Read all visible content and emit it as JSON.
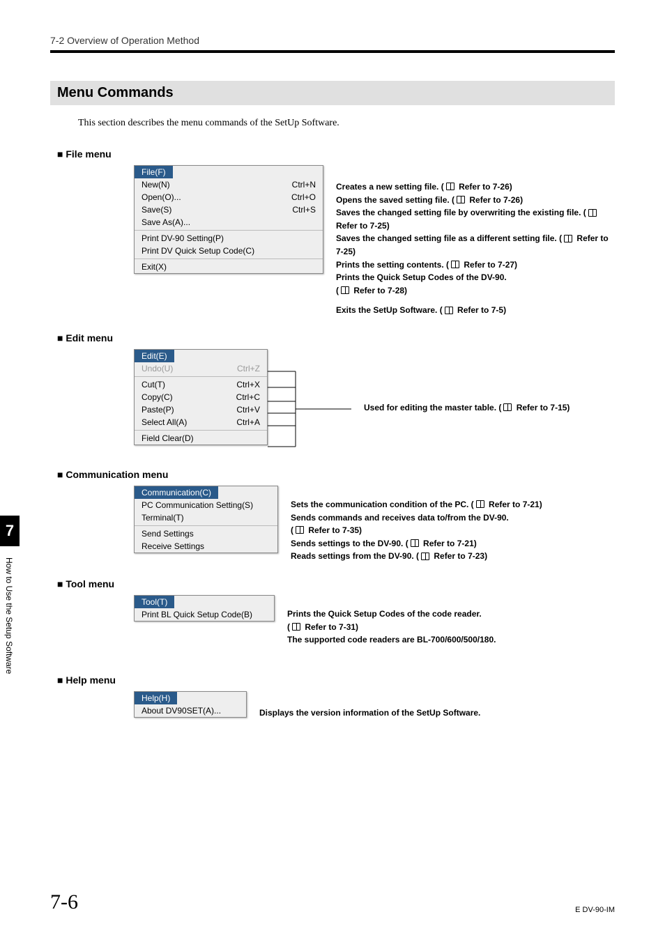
{
  "header": "7-2 Overview of Operation Method",
  "sectionTitle": "Menu Commands",
  "intro": "This section describes the menu commands of the SetUp Software.",
  "sideChapter": "7",
  "sideLabel": "How to Use the Setup Software",
  "pageNumber": "7-6",
  "docId": "E DV-90-IM",
  "fileMenu": {
    "heading": "File menu",
    "title": "File(F)",
    "items": [
      {
        "label": "New(N)",
        "shortcut": "Ctrl+N"
      },
      {
        "label": "Open(O)...",
        "shortcut": "Ctrl+O"
      },
      {
        "label": "Save(S)",
        "shortcut": "Ctrl+S"
      },
      {
        "label": "Save As(A)...",
        "shortcut": ""
      },
      {
        "label": "Print DV-90 Setting(P)",
        "shortcut": ""
      },
      {
        "label": "Print DV Quick Setup Code(C)",
        "shortcut": ""
      },
      {
        "label": "Exit(X)",
        "shortcut": ""
      }
    ],
    "desc": {
      "d1a": "Creates a new setting file. (",
      "d1b": "Refer to 7-26)",
      "d2a": "Opens the saved setting file. (",
      "d2b": "Refer to 7-26)",
      "d3a": "Saves the changed setting file by overwriting the existing file. (",
      "d3b": "Refer to 7-25)",
      "d4a": "Saves the changed setting file as a different setting file. (",
      "d4b": "Refer to 7-25)",
      "d5a": "Prints the setting contents. (",
      "d5b": "Refer to 7-27)",
      "d6a": "Prints the Quick Setup Codes of the DV-90.",
      "d6b": "(",
      "d6c": "Refer to 7-28)",
      "d7a": "Exits the SetUp Software. (",
      "d7b": "Refer to 7-5)"
    }
  },
  "editMenu": {
    "heading": "Edit menu",
    "title": "Edit(E)",
    "items": [
      {
        "label": "Undo(U)",
        "shortcut": "Ctrl+Z",
        "disabled": true
      },
      {
        "label": "Cut(T)",
        "shortcut": "Ctrl+X"
      },
      {
        "label": "Copy(C)",
        "shortcut": "Ctrl+C"
      },
      {
        "label": "Paste(P)",
        "shortcut": "Ctrl+V"
      },
      {
        "label": "Select All(A)",
        "shortcut": "Ctrl+A"
      },
      {
        "label": "Field Clear(D)",
        "shortcut": ""
      }
    ],
    "desc": {
      "d1a": "Used for editing the master table. (",
      "d1b": "Refer to 7-15)"
    }
  },
  "commMenu": {
    "heading": "Communication menu",
    "title": "Communication(C)",
    "items": [
      {
        "label": "PC Communication Setting(S)"
      },
      {
        "label": "Terminal(T)"
      },
      {
        "label": "Send Settings"
      },
      {
        "label": "Receive Settings"
      }
    ],
    "desc": {
      "d1a": "Sets the communication condition of the PC. (",
      "d1b": "Refer to 7-21)",
      "d2a": "Sends commands and receives data to/from the DV-90.",
      "d2b": "(",
      "d2c": "Refer to 7-35)",
      "d3a": "Sends settings to the DV-90. (",
      "d3b": "Refer to 7-21)",
      "d4a": "Reads settings from the DV-90. (",
      "d4b": "Refer to 7-23)"
    }
  },
  "toolMenu": {
    "heading": "Tool menu",
    "title": "Tool(T)",
    "items": [
      {
        "label": "Print BL Quick Setup Code(B)"
      }
    ],
    "desc": {
      "d1a": "Prints the Quick Setup Codes of the code reader.",
      "d1b": "(",
      "d1c": "Refer to 7-31)",
      "d2": "The supported code readers are BL-700/600/500/180."
    }
  },
  "helpMenu": {
    "heading": "Help menu",
    "title": "Help(H)",
    "items": [
      {
        "label": "About DV90SET(A)..."
      }
    ],
    "desc": {
      "d1": "Displays the version information of the SetUp Software."
    }
  }
}
